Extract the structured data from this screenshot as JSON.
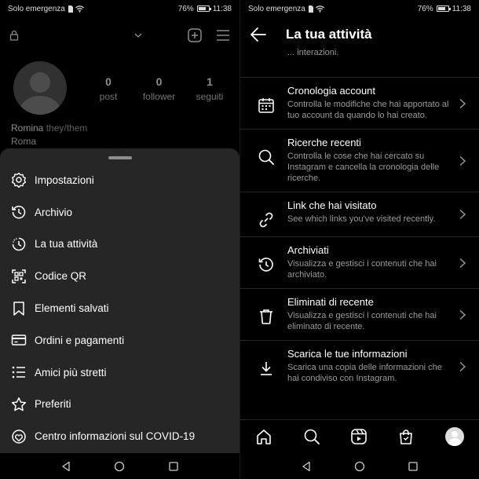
{
  "status_bar": {
    "carrier": "Solo emergenza",
    "battery": "76%",
    "battery_level": 0.76,
    "time": "11:38"
  },
  "profile": {
    "stats": [
      {
        "num": "0",
        "label": "post"
      },
      {
        "num": "0",
        "label": "follower"
      },
      {
        "num": "1",
        "label": "seguiti"
      }
    ],
    "name": "Romina",
    "pronouns": "they/them",
    "location": "Roma"
  },
  "menu": {
    "items": [
      {
        "label": "Impostazioni",
        "icon": "settings-icon"
      },
      {
        "label": "Archivio",
        "icon": "archive-icon"
      },
      {
        "label": "La tua attività",
        "icon": "activity-icon"
      },
      {
        "label": "Codice QR",
        "icon": "qr-code-icon"
      },
      {
        "label": "Elementi salvati",
        "icon": "bookmark-icon"
      },
      {
        "label": "Ordini e pagamenti",
        "icon": "credit-card-icon"
      },
      {
        "label": "Amici più stretti",
        "icon": "close-friends-icon"
      },
      {
        "label": "Preferiti",
        "icon": "star-icon"
      },
      {
        "label": "Centro informazioni sul COVID-19",
        "icon": "covid-info-icon"
      }
    ]
  },
  "activity": {
    "title": "La tua attività",
    "partial_text": "... interazioni.",
    "items": [
      {
        "title": "Cronologia account",
        "desc": "Controlla le modifiche che hai apportato al tuo account da quando lo hai creato.",
        "icon": "calendar-icon"
      },
      {
        "title": "Ricerche recenti",
        "desc": "Controlla le cose che hai cercato su Instagram e cancella la cronologia delle ricerche.",
        "icon": "search-icon"
      },
      {
        "title": "Link che hai visitato",
        "desc": "See which links you've visited recently.",
        "icon": "link-icon"
      },
      {
        "title": "Archiviati",
        "desc": "Visualizza e gestisci i contenuti che hai archiviato.",
        "icon": "archive-icon"
      },
      {
        "title": "Eliminati di recente",
        "desc": "Visualizza e gestisci i contenuti che hai eliminato di recente.",
        "icon": "trash-icon"
      },
      {
        "title": "Scarica le tue informazioni",
        "desc": "Scarica una copia delle informazioni che hai condiviso con Instagram.",
        "icon": "download-icon"
      }
    ]
  },
  "tab_bar": {
    "icons": [
      "home-icon",
      "search-icon",
      "reels-icon",
      "shop-icon",
      "profile-avatar"
    ]
  }
}
